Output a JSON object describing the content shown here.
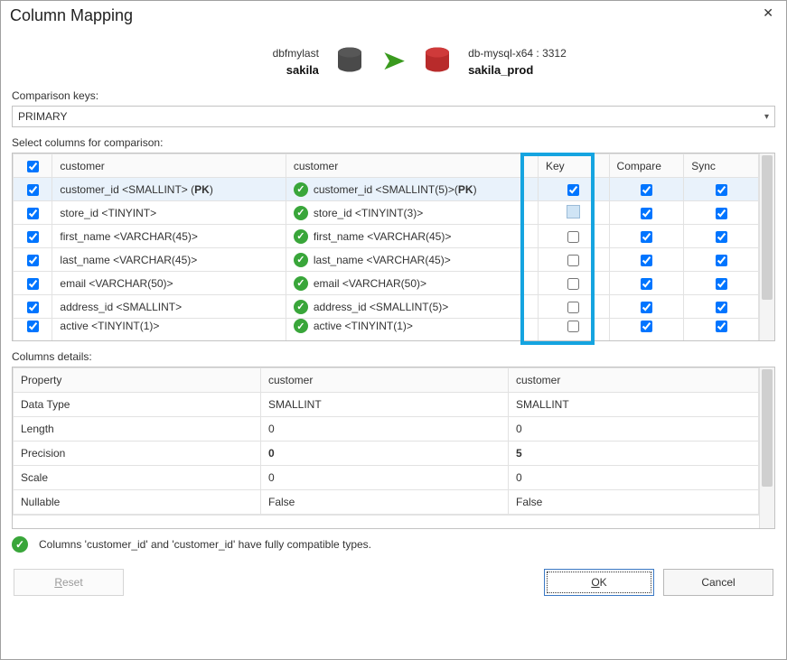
{
  "title": "Column Mapping",
  "source": {
    "connection": "dbfmylast",
    "database": "sakila"
  },
  "target": {
    "connection": "db-mysql-x64 : 3312",
    "database": "sakila_prod"
  },
  "comparison_keys": {
    "label": "Comparison keys:",
    "value": "PRIMARY"
  },
  "columns_section_label": "Select columns for comparison:",
  "columns_headers": {
    "src": "customer",
    "dst": "customer",
    "key": "Key",
    "compare": "Compare",
    "sync": "Sync"
  },
  "rows": [
    {
      "checked": true,
      "selected": true,
      "src": "customer_id <SMALLINT>",
      "src_pk": true,
      "match": true,
      "dst": "customer_id <SMALLINT(5)>",
      "dst_pk": true,
      "key": true,
      "compare": true,
      "sync": true
    },
    {
      "checked": true,
      "src": "store_id <TINYINT>",
      "match": true,
      "dst": "store_id <TINYINT(3)>",
      "key_focus": true,
      "compare": true,
      "sync": true
    },
    {
      "checked": true,
      "src": "first_name <VARCHAR(45)>",
      "match": true,
      "dst": "first_name <VARCHAR(45)>",
      "compare": true,
      "sync": true
    },
    {
      "checked": true,
      "src": "last_name <VARCHAR(45)>",
      "match": true,
      "dst": "last_name <VARCHAR(45)>",
      "compare": true,
      "sync": true
    },
    {
      "checked": true,
      "src": "email <VARCHAR(50)>",
      "match": true,
      "dst": "email <VARCHAR(50)>",
      "compare": true,
      "sync": true
    },
    {
      "checked": true,
      "src": "address_id <SMALLINT>",
      "match": true,
      "dst": "address_id <SMALLINT(5)>",
      "compare": true,
      "sync": true
    },
    {
      "checked": true,
      "cut": true,
      "src": "active <TINYINT(1)>",
      "match": true,
      "dst": "active <TINYINT(1)>",
      "compare": true,
      "sync": true
    }
  ],
  "details_label": "Columns details:",
  "details_headers": {
    "property": "Property",
    "src": "customer",
    "dst": "customer"
  },
  "details_rows": [
    {
      "prop": "Data Type",
      "src": "SMALLINT",
      "dst": "SMALLINT"
    },
    {
      "prop": "Length",
      "src": "0",
      "dst": "0"
    },
    {
      "prop": "Precision",
      "src": "0",
      "dst": "5",
      "bold": true
    },
    {
      "prop": "Scale",
      "src": "0",
      "dst": "0"
    },
    {
      "prop": "Nullable",
      "src": "False",
      "dst": "False"
    }
  ],
  "status_message": "Columns 'customer_id' and 'customer_id' have fully compatible types.",
  "buttons": {
    "reset": "Reset",
    "ok": "OK",
    "cancel": "Cancel"
  },
  "chart_data": null
}
